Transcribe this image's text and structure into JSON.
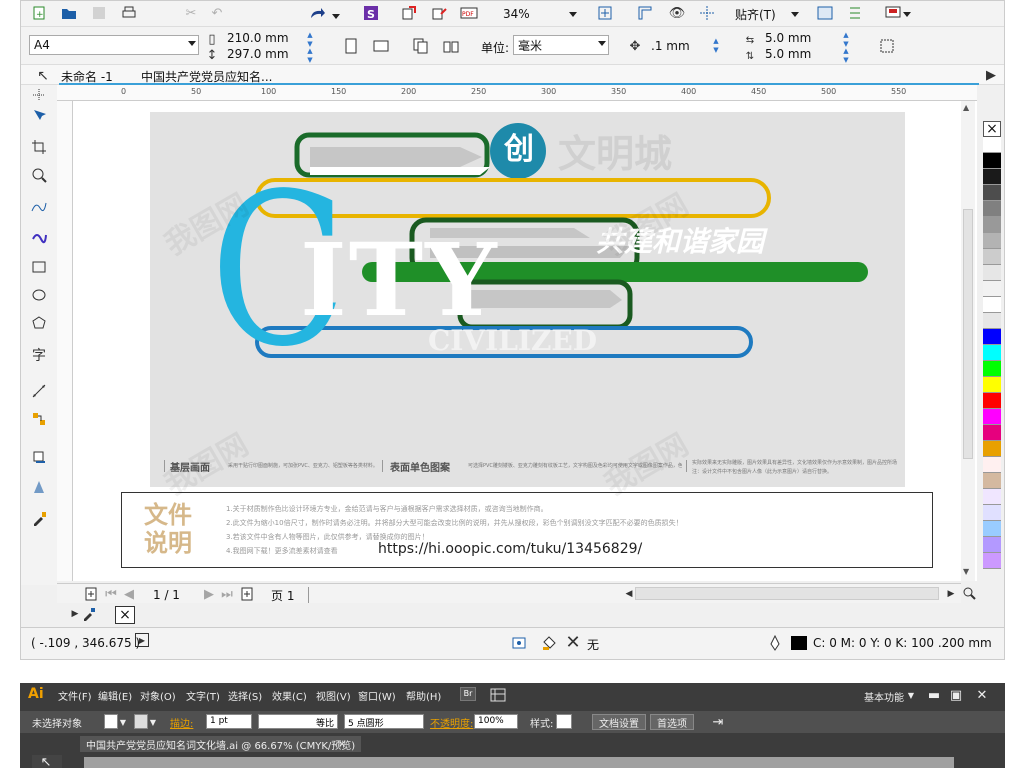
{
  "cdr": {
    "toolbar1": {
      "zoom": "34%",
      "snap_label": "贴齐(T)"
    },
    "toolbar2": {
      "page_size": "A4",
      "width": "210.0 mm",
      "height": "297.0 mm",
      "unit_label": "单位:",
      "unit": "毫米",
      "nudge": ".1 mm",
      "dup_x": "5.0 mm",
      "dup_y": "5.0 mm"
    },
    "tabs": [
      "未命名 -1",
      "中国共产党党员应知名..."
    ],
    "ruler_ticks": [
      "0",
      "50",
      "100",
      "150",
      "200",
      "250",
      "300",
      "350",
      "400",
      "450",
      "500",
      "550"
    ],
    "artwork": {
      "chuang": "创",
      "wenmingcheng": "文明城",
      "slogan": "共建和谐家园",
      "city_c": "C",
      "city_rest": "ITY",
      "civilized": "CIVILIZED",
      "spec1_title": "基层画面",
      "spec1_text": "采用干贴行印图面制施，可加张PVC、亚克力、铝塑板等各类材料。",
      "spec2_title": "表面单色图案",
      "spec2_text": "可选择PVC雕刻镂板、亚克力雕刻有纹板工艺，文字构图及色彩均可使用文字或图像图案作品，色彩鉴赏",
      "spec3_text": "实际效果来无实际雕版，图片效果具有差异性，文化墙效果仅作为示意效果制，图片品控所场景看参考请以。",
      "spec3_text2": "注：设计文件中不包含图片人像（此为示意图片）请自行替换。"
    },
    "info": {
      "title1": "文件",
      "title2": "说明",
      "lines": [
        "1.关于材质制作色比设计环境方专业，金给范请与客户与通根据客户需求选择材质，或咨询当地制作商。",
        "2.此文件为缩小10倍尺寸，制作时请务必注明。并将部分大型可能会改变比例的说明，并先从搜权段，彩色个别调别没文字匹配不必要的色质损失！",
        "3.若该文件中含有人物等图片，此仅供参考，请替换成你的图片！",
        "4.我图网下载！更多流差素材请查看"
      ],
      "url": "https://hi.ooopic.com/tuku/13456829/"
    },
    "pagenav": {
      "current": "1 / 1",
      "page_tab": "页 1"
    },
    "status": {
      "coords": "( -.109 , 346.675 )",
      "fill_none": "无",
      "color_info": "C: 0 M: 0 Y: 0 K: 100  .200 mm"
    },
    "palette": [
      "#ffffff",
      "#000000",
      "#1a1a1a",
      "#4d4d4d",
      "#808080",
      "#999999",
      "#b3b3b3",
      "#cccccc",
      "#e6e6e6",
      "#f2f2f2",
      "#ffffff",
      "#e6e6e6",
      "#0000ff",
      "#00ffff",
      "#00ff00",
      "#ffff00",
      "#ff0000",
      "#ff00ff",
      "#e6007e",
      "#e8a000",
      "#fff0f0",
      "#d4b9a0",
      "#f0e6ff",
      "#e0e0ff",
      "#99ccff",
      "#b399ff",
      "#cc99ff"
    ]
  },
  "ai": {
    "logo": "Ai",
    "menu": [
      "文件(F)",
      "编辑(E)",
      "对象(O)",
      "文字(T)",
      "选择(S)",
      "效果(C)",
      "视图(V)",
      "窗口(W)",
      "帮助(H)"
    ],
    "br": "Br",
    "workspace": "基本功能",
    "control": {
      "no_selection": "未选择对象",
      "stroke_label": "描边:",
      "stroke_val": "1 pt",
      "line_style": "等比",
      "brush": "5 点圆形",
      "opacity_label": "不透明度:",
      "opacity": "100%",
      "style_label": "样式:",
      "doc_setup": "文档设置",
      "prefs": "首选项"
    },
    "doc_tab": "中国共产党党员应知名词文化墙.ai @ 66.67% (CMYK/预览)",
    "close": "×"
  },
  "watermark": "我图网"
}
